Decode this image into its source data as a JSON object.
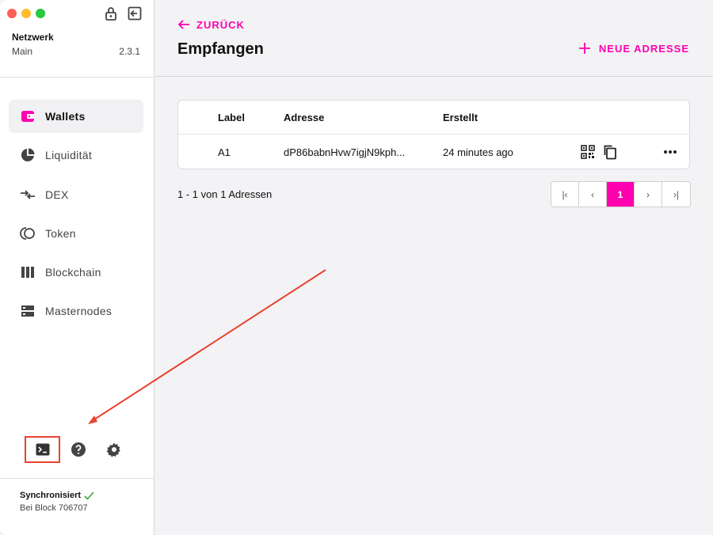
{
  "sidebar": {
    "network_title": "Netzwerk",
    "network_name": "Main",
    "version": "2.3.1",
    "nav": [
      {
        "label": "Wallets",
        "icon": "wallet-icon",
        "active": true
      },
      {
        "label": "Liquidität",
        "icon": "pie-chart-icon"
      },
      {
        "label": "DEX",
        "icon": "swap-arrows-icon"
      },
      {
        "label": "Token",
        "icon": "token-icon"
      },
      {
        "label": "Blockchain",
        "icon": "blocks-icon"
      },
      {
        "label": "Masternodes",
        "icon": "server-icon"
      }
    ],
    "sync": {
      "status": "Synchronisiert",
      "block": "Bei Block 706707"
    }
  },
  "header": {
    "back_label": "ZURÜCK",
    "title": "Empfangen",
    "new_address_label": "NEUE ADRESSE"
  },
  "table": {
    "columns": {
      "label": "Label",
      "address": "Adresse",
      "created": "Erstellt"
    },
    "rows": [
      {
        "label": "A1",
        "address": "dP86babnHvw7igjN9kph...",
        "created": "24 minutes ago"
      }
    ]
  },
  "pagination": {
    "info": "1 - 1 von 1 Adressen",
    "first": "|‹",
    "prev": "‹",
    "current": "1",
    "next": "›",
    "last": "›|"
  },
  "colors": {
    "accent": "#ff00af",
    "annotation": "#e8432f"
  }
}
